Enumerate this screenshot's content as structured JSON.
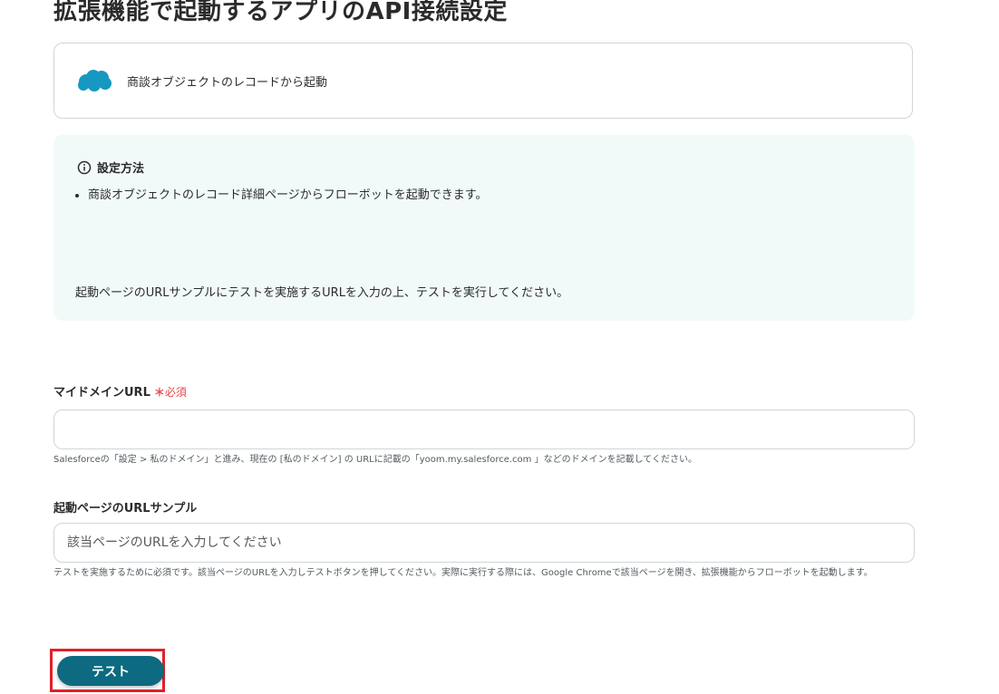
{
  "page": {
    "title": "拡張機能で起動するアプリのAPI接続設定"
  },
  "trigger": {
    "app_icon": "salesforce-cloud-logo",
    "label": "商談オブジェクトのレコードから起動"
  },
  "info": {
    "icon": "info-circle-icon",
    "title": "設定方法",
    "items": [
      "商談オブジェクトのレコード詳細ページからフローボットを起動できます。"
    ],
    "footer": "起動ページのURLサンプルにテストを実施するURLを入力の上、テストを実行してください。"
  },
  "fields": {
    "domain": {
      "label": "マイドメインURL",
      "required_mark": "＊",
      "required_label": "必須",
      "value": "",
      "placeholder": "",
      "hint": "Salesforceの「設定 > 私のドメイン」と進み、現在の [私のドメイン] の URLに記載の「yoom.my.salesforce.com 」などのドメインを記載してください。"
    },
    "sample_url": {
      "label": "起動ページのURLサンプル",
      "value": "",
      "placeholder": "該当ページのURLを入力してください",
      "hint": "テストを実施するために必須です。該当ページのURLを入力しテストボタンを押してください。実際に実行する際には、Google Chromeで該当ページを開き、拡張機能からフローボットを起動します。"
    }
  },
  "actions": {
    "test_label": "テスト"
  },
  "colors": {
    "salesforce_blue": "#1798c1",
    "button_teal": "#0e6a80",
    "required_red": "#e5484d",
    "highlight_red": "#e0202a",
    "info_bg": "#f2f9f9"
  }
}
